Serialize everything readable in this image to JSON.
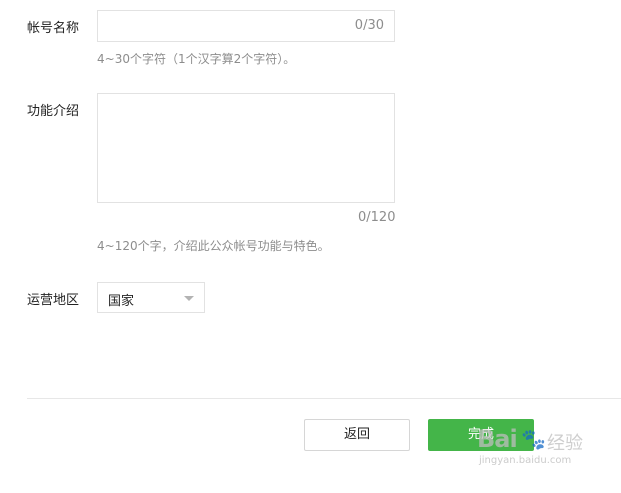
{
  "form": {
    "account_name": {
      "label": "帐号名称",
      "value": "",
      "counter": "0/30",
      "hint": "4~30个字符（1个汉字算2个字符）。"
    },
    "description": {
      "label": "功能介绍",
      "value": "",
      "counter": "0/120",
      "hint": "4~120个字，介绍此公众帐号功能与特色。"
    },
    "region": {
      "label": "运营地区",
      "selected": "国家"
    }
  },
  "actions": {
    "back_label": "返回",
    "done_label": "完成"
  },
  "watermark": {
    "logo_text": "Bai",
    "paw": "🐾",
    "suffix": "经验",
    "url": "jingyan.baidu.com"
  },
  "colors": {
    "primary": "#44b549",
    "border": "#e2e2e2",
    "hint_text": "#8d8d8d"
  }
}
